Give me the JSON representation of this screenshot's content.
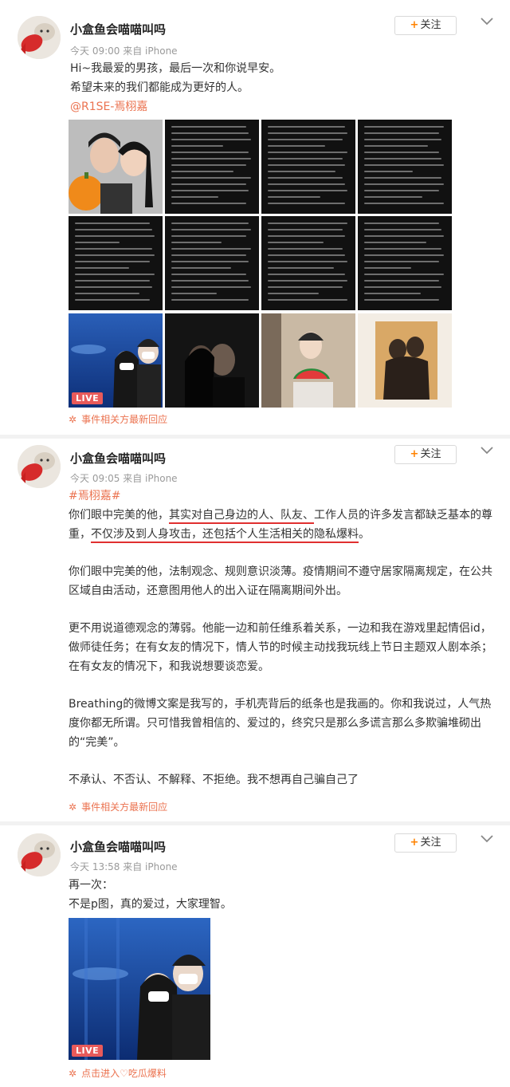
{
  "posts": [
    {
      "username": "小盒鱼会喵喵叫吗",
      "time": "今天 09:00",
      "source": "来自 iPhone",
      "follow_label": "关注",
      "lines": [
        "Hi~我最爱的男孩，最后一次和你说早安。",
        "希望未来的我们都能成为更好的人。"
      ],
      "mention": "@R1SE-焉栩嘉",
      "live_badge": "LIVE",
      "footnote": "事件相关方最新回应"
    },
    {
      "username": "小盒鱼会喵喵叫吗",
      "time": "今天 09:05",
      "source": "来自 iPhone",
      "follow_label": "关注",
      "hashtag": "#焉栩嘉#",
      "p1_a": "你们眼中完美的他，",
      "p1_b": "其实对自己身边的人、队友、",
      "p1_c": "工作人员的许多发言都缺乏基本的尊重，",
      "p1_d": "不仅涉及到人身攻击，还包括个人生活相关的隐私爆料",
      "p1_e": "。",
      "p2": "你们眼中完美的他，法制观念、规则意识淡薄。疫情期间不遵守居家隔离规定，在公共区域自由活动，还意图用他人的出入证在隔离期间外出。",
      "p3": "更不用说道德观念的薄弱。他能一边和前任维系着关系，一边和我在游戏里起情侣id，做师徒任务；在有女友的情况下，情人节的时候主动找我玩线上节日主题双人剧本杀；在有女友的情况下，和我说想要谈恋爱。",
      "p4": "Breathing的微博文案是我写的，手机壳背后的纸条也是我画的。你和我说过，人气热度你都无所谓。只可惜我曾相信的、爱过的，终究只是那么多谎言那么多欺骗堆砌出的“完美”。",
      "p5": "不承认、不否认、不解释、不拒绝。我不想再自己骗自己了",
      "footnote": "事件相关方最新回应"
    },
    {
      "username": "小盒鱼会喵喵叫吗",
      "time": "今天 13:58",
      "source": "来自 iPhone",
      "follow_label": "关注",
      "lines": [
        "再一次：",
        "不是p图，真的爱过，大家理智。"
      ],
      "live_badge": "LIVE",
      "footnote": "点击进入♡吃瓜爆料"
    }
  ],
  "colors": {
    "accent_link": "#eb7350",
    "follow_plus": "#ff8200",
    "underline": "#e03030",
    "live_badge": "#e85a5a"
  }
}
